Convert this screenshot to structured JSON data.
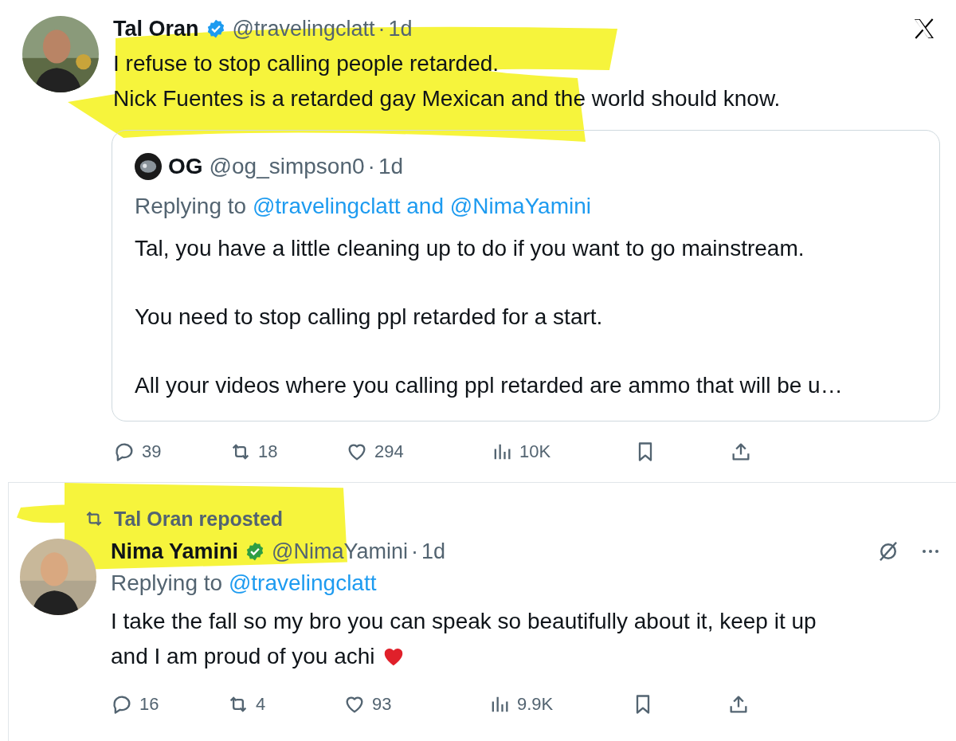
{
  "posts": [
    {
      "highlighted": true,
      "author": {
        "name": "Tal Oran",
        "verified_badge": {
          "color": "#1d9bf0"
        },
        "handle": "@travelingclatt",
        "separator": "·",
        "time": "1d"
      },
      "header_icon": {
        "kind": "logo"
      },
      "lines": [
        "I refuse to stop calling people retarded.",
        "Nick Fuentes is a retarded gay Mexican and the world should know."
      ],
      "quote": {
        "author": {
          "name": "OG",
          "handle": "@og_simpson0",
          "separator": "·",
          "time": "1d"
        },
        "replying_label": "Replying to",
        "replying_to": "@travelingclatt and @NimaYamini",
        "paragraphs": [
          "Tal, you have a little cleaning up to do if you want to go mainstream.",
          "You need to stop calling ppl retarded for a start.",
          "All your videos where you calling ppl retarded are ammo that will be u…"
        ]
      },
      "actions": [
        {
          "kind": "reply",
          "count": "39"
        },
        {
          "kind": "repost",
          "count": "18"
        },
        {
          "kind": "like",
          "count": "294"
        },
        {
          "kind": "views",
          "count": "10K"
        },
        {
          "kind": "bookmark"
        },
        {
          "kind": "share"
        }
      ]
    },
    {
      "highlighted": true,
      "repost_label": "Tal Oran reposted",
      "author": {
        "name": "Nima Yamini",
        "verified_badge": {
          "color": "#2e9e44"
        },
        "handle": "@NimaYamini",
        "separator": "·",
        "time": "1d"
      },
      "header_icon": {
        "kind": "more"
      },
      "replying_label": "Replying to",
      "replying_to": "@travelingclatt",
      "lines": [
        "I take the fall so my bro you can speak so beautifully about it, keep it up",
        "and I am proud of you achi"
      ],
      "heart": true,
      "actions": [
        {
          "kind": "reply",
          "count": "16"
        },
        {
          "kind": "repost",
          "count": "4"
        },
        {
          "kind": "like",
          "count": "93"
        },
        {
          "kind": "views",
          "count": "9.9K"
        },
        {
          "kind": "bookmark"
        },
        {
          "kind": "share"
        }
      ]
    }
  ]
}
